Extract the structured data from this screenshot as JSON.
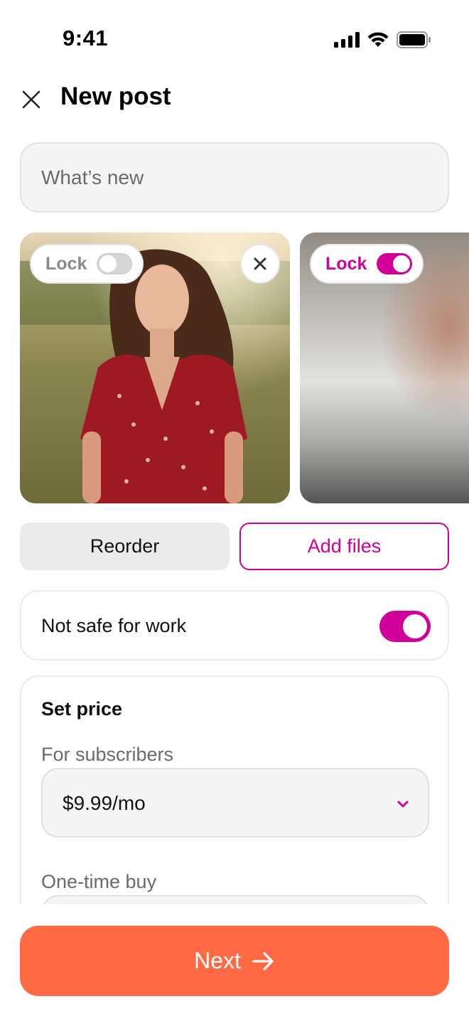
{
  "status_bar": {
    "time": "9:41",
    "icons": [
      "signal-icon",
      "wifi-icon",
      "battery-icon"
    ]
  },
  "header": {
    "title": "New post",
    "close_icon": "close-icon"
  },
  "post_input": {
    "placeholder": "What’s new",
    "value": ""
  },
  "media": [
    {
      "lock_label": "Lock",
      "locked": false,
      "removable": true
    },
    {
      "lock_label": "Lock",
      "locked": true,
      "removable": false
    }
  ],
  "actions": {
    "reorder_label": "Reorder",
    "add_files_label": "Add files"
  },
  "nsfw": {
    "label": "Not safe for work",
    "enabled": true
  },
  "pricing": {
    "title": "Set price",
    "subscribers_label": "For subscribers",
    "subscribers_value": "$9.99/mo",
    "one_time_label": "One-time buy",
    "one_time_value": ""
  },
  "footer": {
    "next_label": "Next",
    "next_icon": "arrow-right-icon"
  },
  "colors": {
    "accent": "#d1009a",
    "primary_button": "#ff6a45",
    "field_bg": "#f5f5f5"
  }
}
